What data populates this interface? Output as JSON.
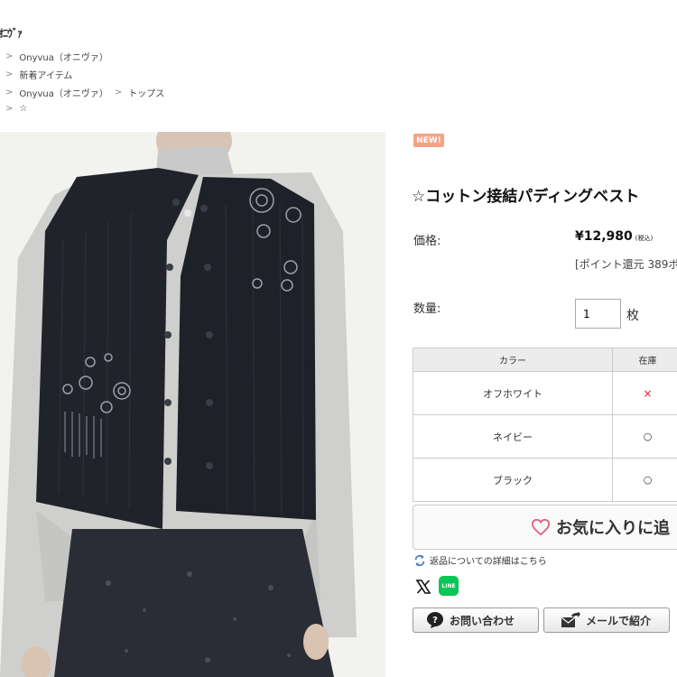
{
  "logo": {
    "text": "ｵﾆｳﾞｧ"
  },
  "breadcrumbs": [
    {
      "items": [
        "Onyvua（オニヴァ）"
      ]
    },
    {
      "items": [
        "新着アイテム"
      ]
    },
    {
      "items": [
        "Onyvua（オニヴァ）",
        "トップス"
      ]
    },
    {
      "items": [
        "☆"
      ]
    }
  ],
  "product": {
    "badge": "NEW!",
    "title": "☆コットン接結パディングベスト",
    "price_label": "価格:",
    "price": "¥12,980",
    "tax_note": "(税込)",
    "points": "[ポイント還元 389ポ",
    "qty_label": "数量:",
    "qty_value": "1",
    "qty_unit": "枚"
  },
  "stock_table": {
    "headers": [
      "カラー",
      "在庫"
    ],
    "rows": [
      {
        "color": "オフホワイト",
        "stock": "×"
      },
      {
        "color": "ネイビー",
        "stock": "○"
      },
      {
        "color": "ブラック",
        "stock": "○"
      }
    ]
  },
  "favorite_button": "お気に入りに追",
  "returns_link": "返品についての詳細はこちら",
  "share": {
    "line_label": "LINE"
  },
  "buttons": {
    "inquiry": "お問い合わせ",
    "mail": "メールで紹介"
  },
  "colors": {
    "badge": "#f4a287",
    "line": "#06c755",
    "heart": "#e0607e",
    "sold_out": "#dd2222"
  }
}
